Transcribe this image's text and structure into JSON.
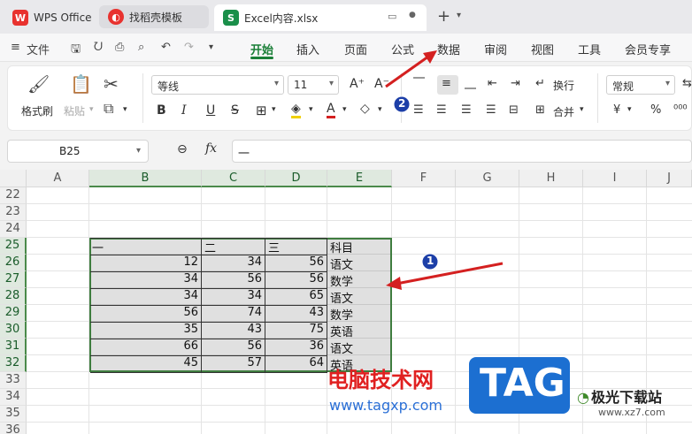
{
  "tabs": [
    {
      "label": "WPS Office",
      "icon": "wps-logo-icon"
    },
    {
      "label": "找稻壳模板",
      "icon": "docer-icon"
    },
    {
      "label": "Excel内容.xlsx",
      "icon": "spreadsheet-icon",
      "badge": "S"
    }
  ],
  "menu": {
    "file": "文件",
    "items": [
      "开始",
      "插入",
      "页面",
      "公式",
      "数据",
      "审阅",
      "视图",
      "工具",
      "会员专享"
    ],
    "active": "开始"
  },
  "ribbon": {
    "format_painter": "格式刷",
    "paste": "粘贴",
    "font_name": "等线",
    "font_size": "11",
    "wrap_text": "换行",
    "merge": "合并",
    "number_format": "常规"
  },
  "formula_bar": {
    "cell_ref": "B25",
    "fx": "fx",
    "content": "一"
  },
  "columns": [
    "A",
    "B",
    "C",
    "D",
    "E",
    "F",
    "G",
    "H",
    "I",
    "J"
  ],
  "rows": [
    "22",
    "23",
    "24",
    "25",
    "26",
    "27",
    "28",
    "29",
    "30",
    "31",
    "32",
    "33",
    "34",
    "35",
    "36"
  ],
  "table": {
    "header": [
      "一",
      "二",
      "三",
      "科目"
    ],
    "rows": [
      [
        "12",
        "34",
        "56",
        "语文"
      ],
      [
        "34",
        "56",
        "56",
        "数学"
      ],
      [
        "34",
        "34",
        "65",
        "语文"
      ],
      [
        "56",
        "74",
        "43",
        "数学"
      ],
      [
        "35",
        "43",
        "75",
        "英语"
      ],
      [
        "66",
        "56",
        "36",
        "语文"
      ],
      [
        "45",
        "57",
        "64",
        "英语"
      ]
    ]
  },
  "annotations": {
    "step1": "1",
    "step2": "2",
    "arrow_color": "#d42020"
  },
  "watermark": {
    "site_text": "电脑技术网",
    "url": "www.tagxp.com",
    "tag": "TAG",
    "site2": "极光下载站",
    "url2": "www.xz7.com"
  },
  "colors": {
    "accent": "#1a7f37",
    "selection_border": "#3f7d3f",
    "annotation": "#d42020",
    "tag_blue": "#1c6fd1"
  }
}
